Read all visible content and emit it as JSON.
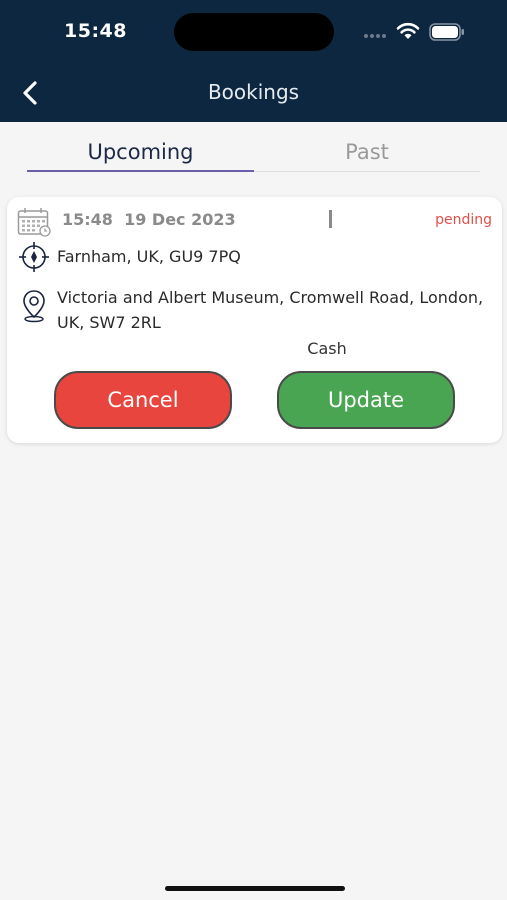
{
  "status_bar": {
    "time": "15:48",
    "icons": [
      "signal-icon",
      "wifi-icon",
      "battery-icon"
    ]
  },
  "header": {
    "title": "Bookings",
    "back_icon": "chevron-left-icon",
    "background_color": "#0d2740"
  },
  "tabs": [
    {
      "label": "Upcoming",
      "active": true
    },
    {
      "label": "Past",
      "active": false
    }
  ],
  "booking": {
    "time": "15:48",
    "date": "19 Dec 2023",
    "status": "pending",
    "pickup": "Farnham, UK, GU9 7PQ",
    "dropoff": "Victoria and Albert Museum, Cromwell Road, London, UK, SW7 2RL",
    "payment_method": "Cash",
    "cancel_label": "Cancel",
    "update_label": "Update",
    "icons": [
      "calendar-icon",
      "crosshair-icon",
      "location-pin-icon"
    ]
  },
  "colors": {
    "cancel": "#e8453e",
    "update": "#4aa552",
    "pending": "#e0514a",
    "tab_active": "#6a5fa8"
  }
}
